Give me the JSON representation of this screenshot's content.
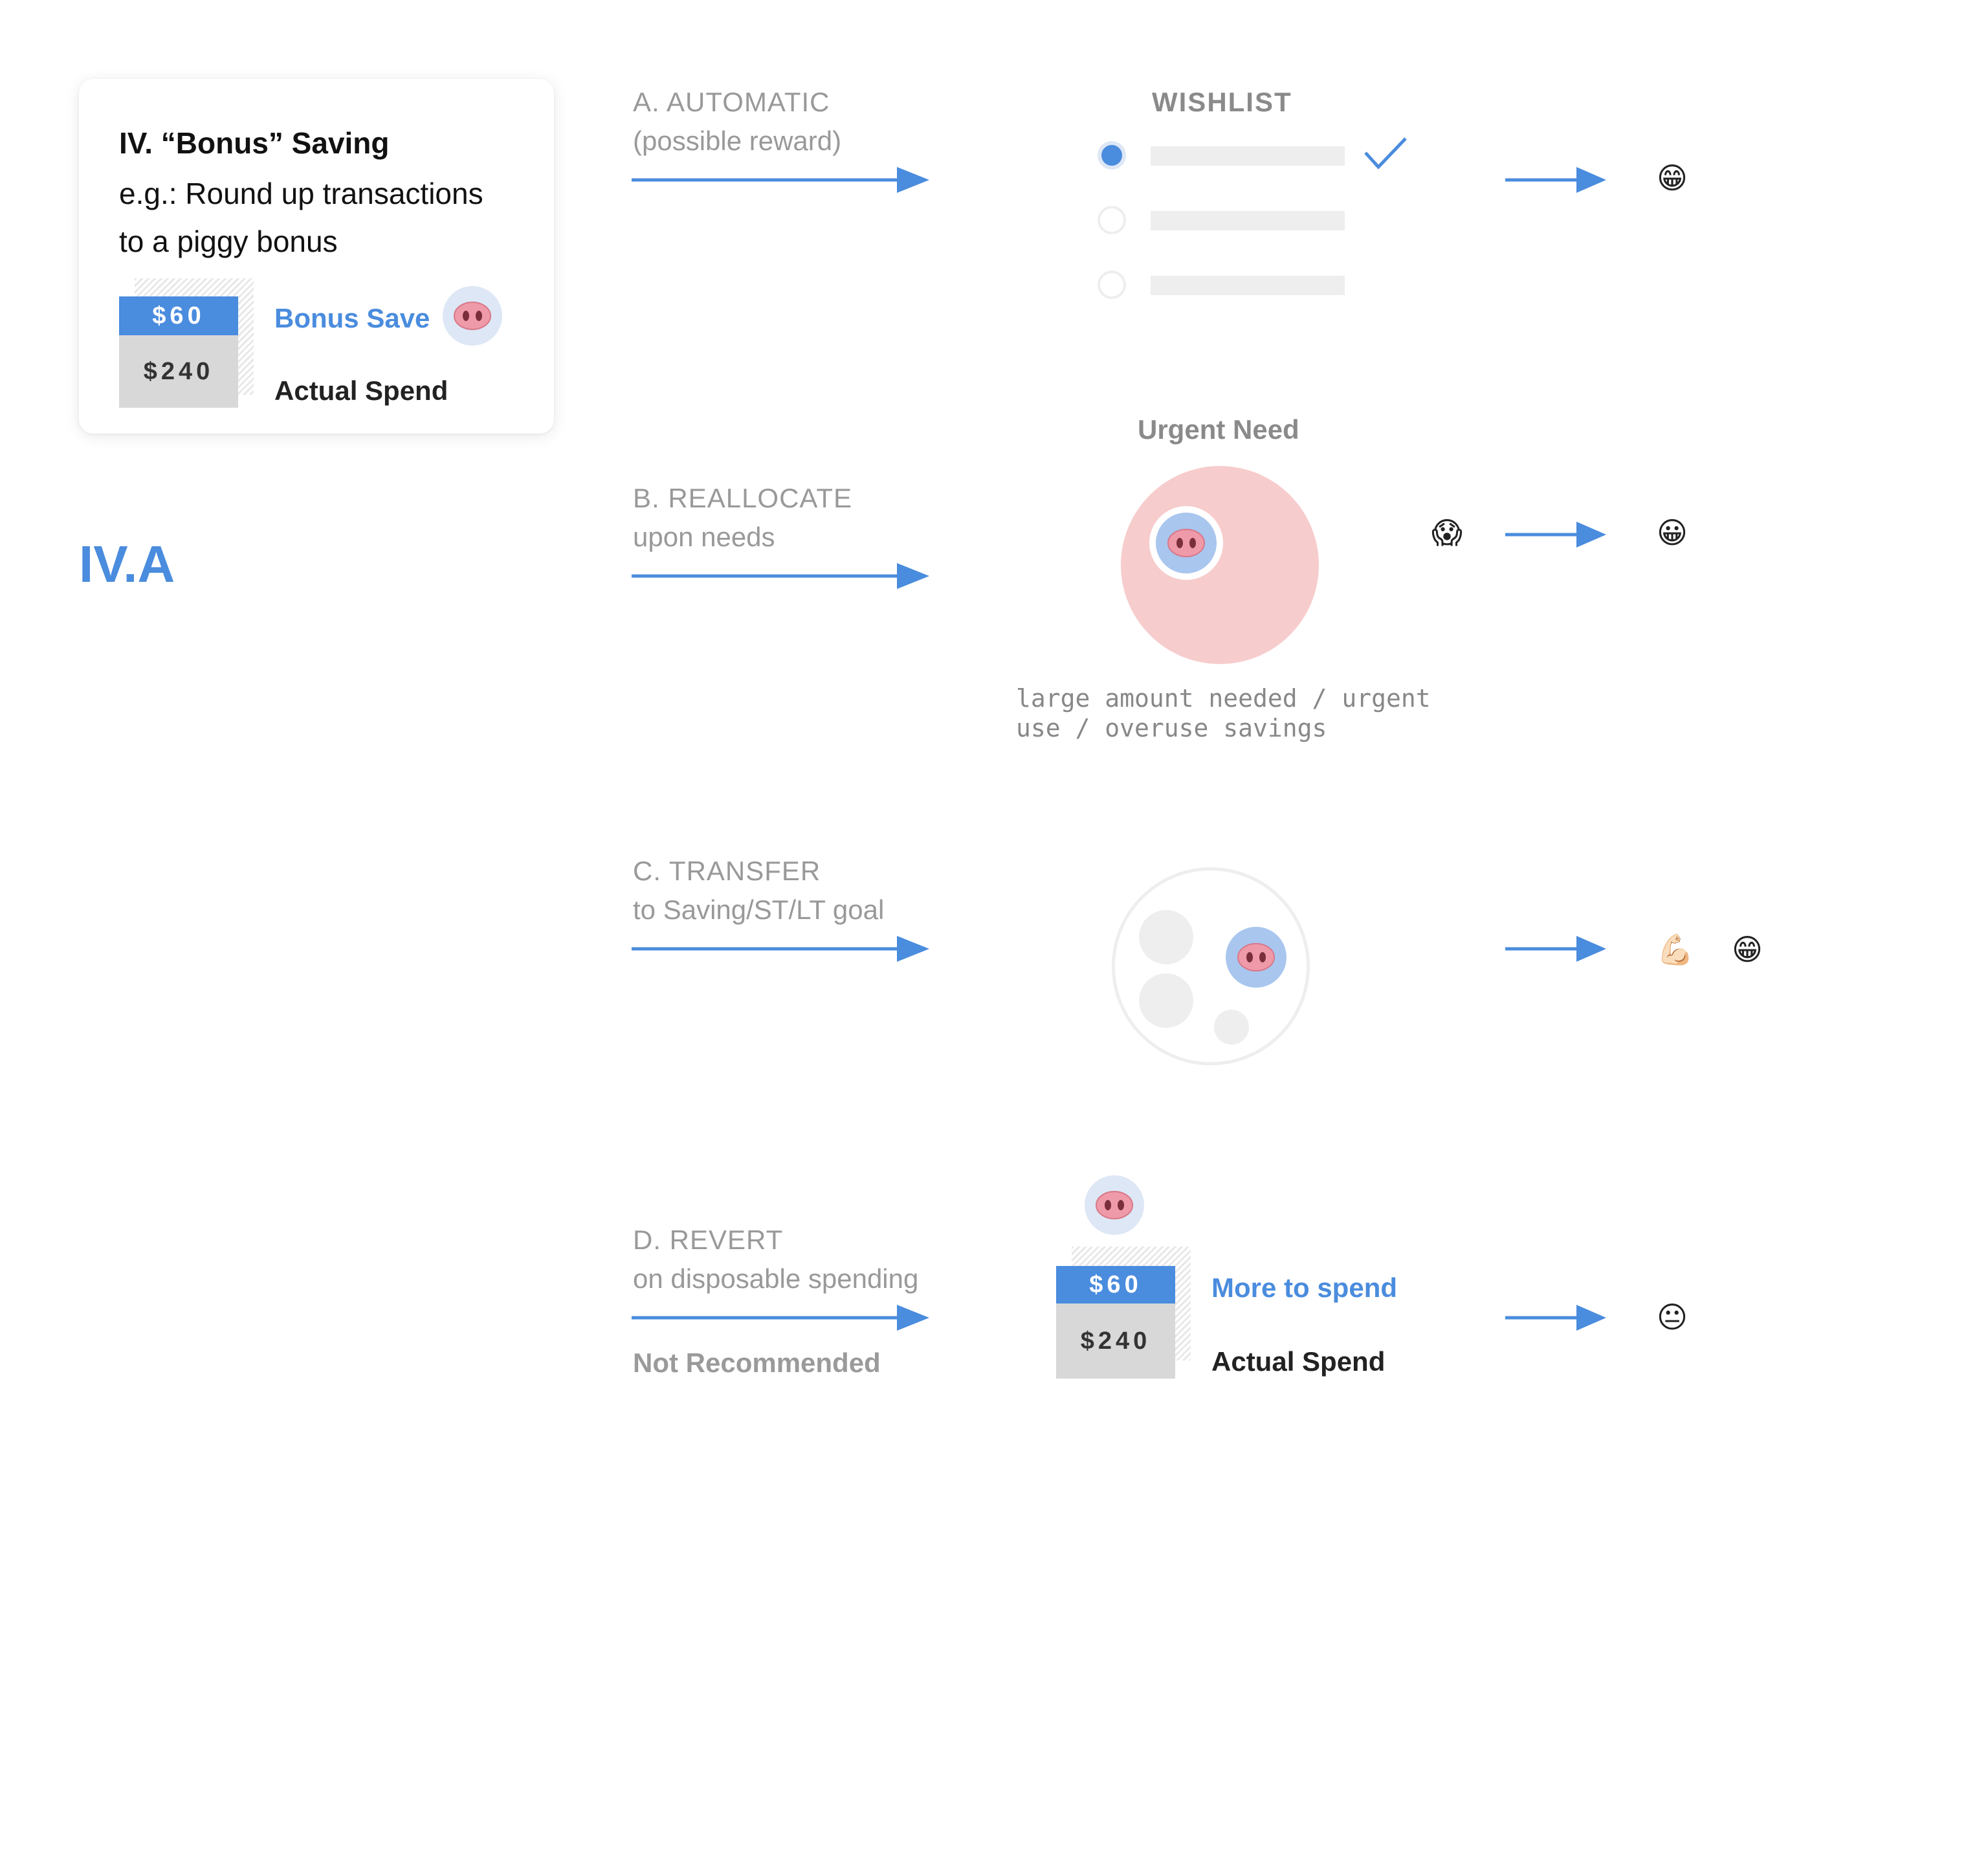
{
  "card": {
    "title": "IV. “Bonus” Saving",
    "desc_line1": "e.g.: Round up transactions",
    "desc_line2": "to a piggy bonus",
    "save_amount": "$60",
    "spend_amount": "$240",
    "save_label": "Bonus Save",
    "spend_label": "Actual Spend"
  },
  "section_id": "IV.A",
  "steps": [
    {
      "title": "A. AUTOMATIC",
      "subtitle": "(possible reward)"
    },
    {
      "title": "B. REALLOCATE",
      "subtitle": "upon needs"
    },
    {
      "title": "C. TRANSFER",
      "subtitle": "to Saving/ST/LT goal"
    },
    {
      "title": "D. REVERT",
      "subtitle": "on disposable spending",
      "note": "Not Recommended"
    }
  ],
  "wishlist": {
    "heading": "WISHLIST",
    "selected_index": 0
  },
  "urgent": {
    "heading": "Urgent Need",
    "note_line1": "large amount needed / urgent",
    "note_line2": "use / overuse savings"
  },
  "revert": {
    "save_amount": "$60",
    "spend_amount": "$240",
    "save_label": "More to spend",
    "spend_label": "Actual Spend"
  },
  "outcomes": {
    "a": "😁",
    "b_before": "😱",
    "b": "😀",
    "c_first": "💪🏻",
    "c_second": "😁",
    "d": "😐"
  },
  "colors": {
    "accent": "#4a8cde",
    "muted": "#999999",
    "urgent_bg": "#f7cccc",
    "pig_bg": "#dde7f5"
  },
  "icons": {
    "pig": "pig-nose-icon",
    "arrow": "arrow-right-icon",
    "check": "checkmark-icon"
  }
}
